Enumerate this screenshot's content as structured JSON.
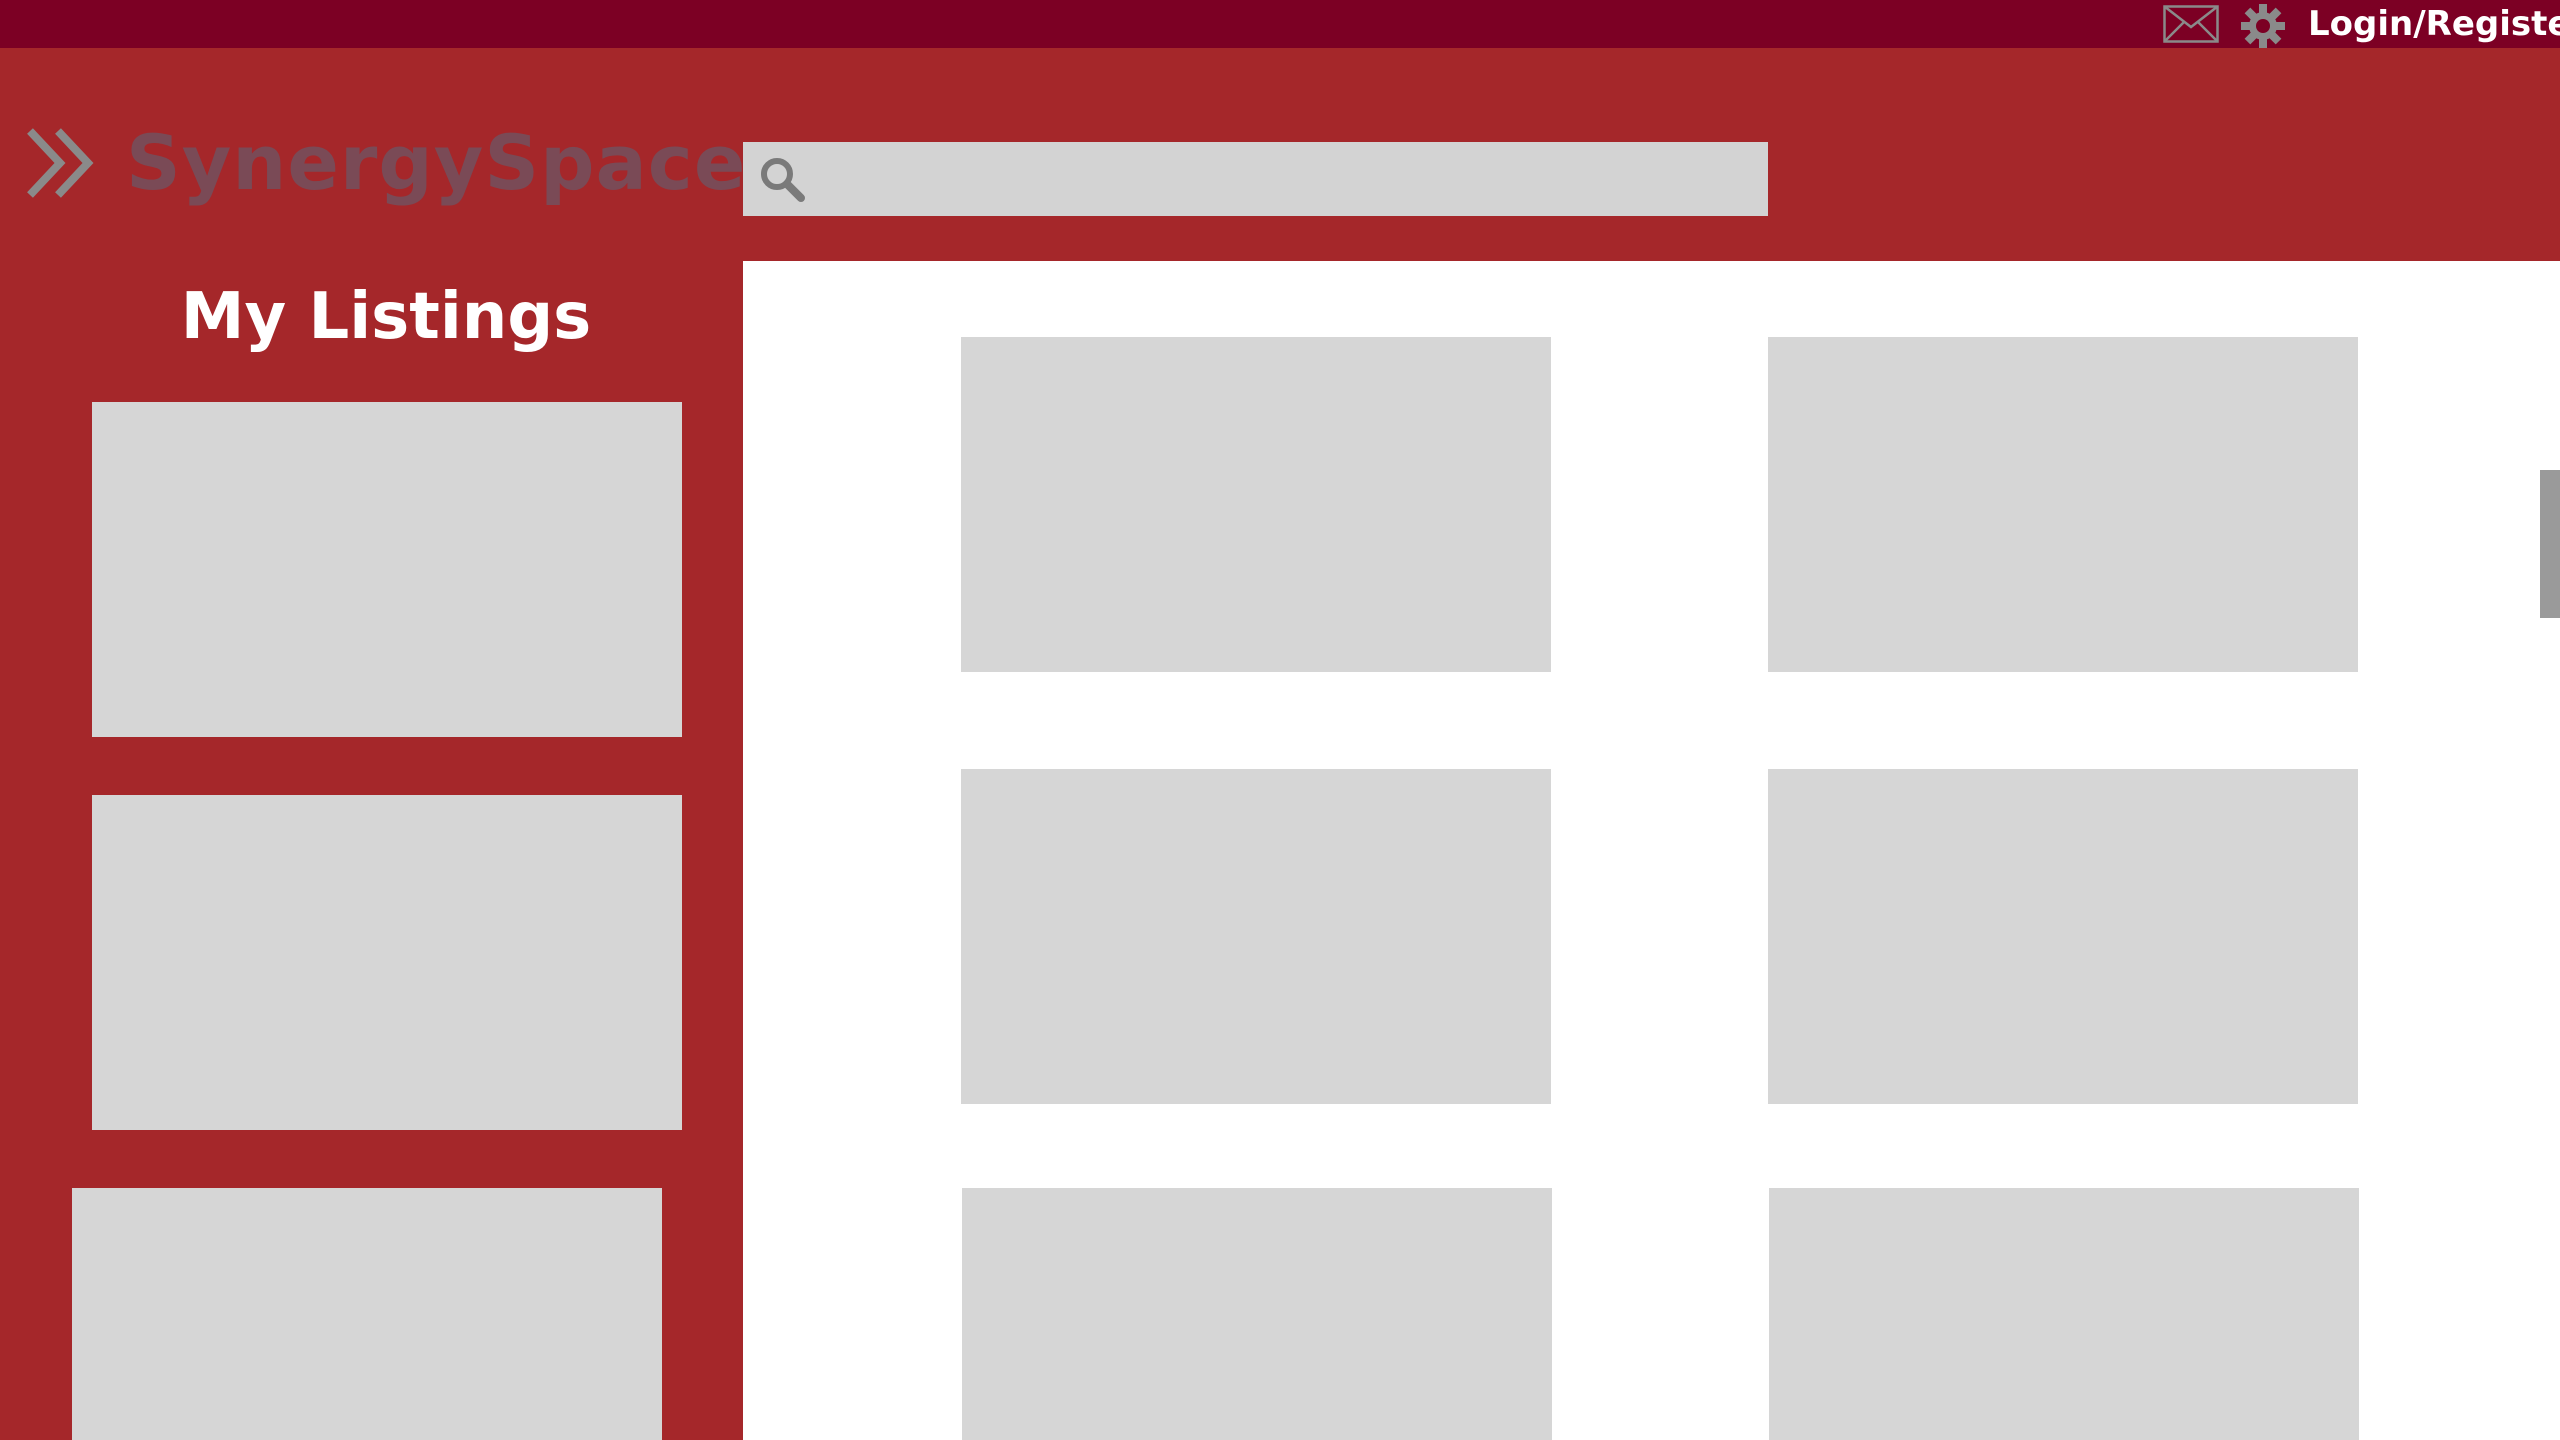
{
  "topbar": {
    "mail_icon": "mail-icon",
    "settings_icon": "gear-icon",
    "login_label": "Login/Register"
  },
  "brand": {
    "logo_icon": "double-chevron-right-icon",
    "name": "SynergySpace"
  },
  "search": {
    "icon": "search-icon",
    "placeholder": "",
    "value": ""
  },
  "sidebar": {
    "title": "My Listings",
    "listing_count_visible": 3
  },
  "main": {
    "listing_cards_visible": 6
  },
  "colors": {
    "topbar_bg": "#7c0024",
    "page_bg": "#a5272a",
    "brand_text": "#7a4a56",
    "placeholder_card": "#d6d6d6",
    "main_bg": "#ffffff"
  }
}
